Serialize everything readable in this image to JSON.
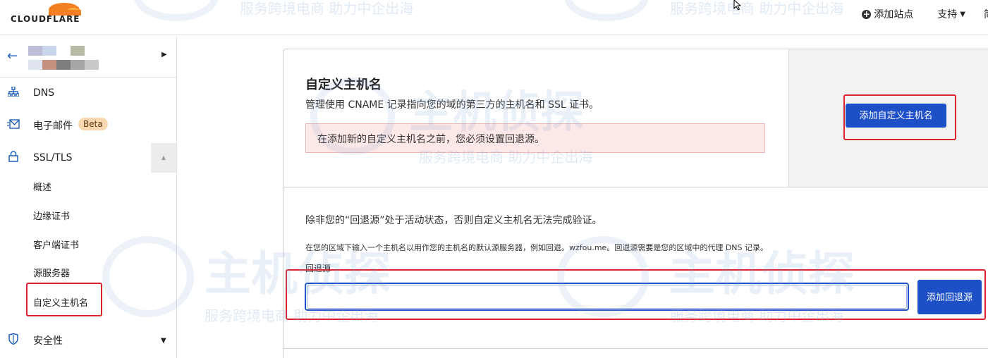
{
  "header": {
    "brand": "CLOUDFLARE",
    "add_site": "添加站点",
    "support": "支持",
    "lang": "简"
  },
  "sidebar": {
    "items": [
      {
        "label": "DNS",
        "icon": "sitemap-icon"
      },
      {
        "label": "电子邮件",
        "icon": "envelope-icon",
        "badge": "Beta"
      },
      {
        "label": "SSL/TLS",
        "icon": "lock-icon"
      },
      {
        "label": "安全性",
        "icon": "shield-icon"
      }
    ],
    "ssl_sub": [
      "概述",
      "边缘证书",
      "客户端证书",
      "源服务器",
      "自定义主机名"
    ]
  },
  "main": {
    "title": "自定义主机名",
    "description": "管理使用 CNAME 记录指向您的域的第三方的主机名和 SSL 证书。",
    "warning": "在添加新的自定义主机名之前，您必须设置回退源。",
    "add_hostname_button": "添加自定义主机名",
    "fallback_note": "除非您的“回退源”处于活动状态，否则自定义主机名无法完成验证。",
    "fallback_detail": "在您的区域下输入一个主机名以用作您的主机名的默认源服务器，例如回退。wzfou.me。回退源需要是您的区域中的代理 DNS 记录。",
    "fallback_label": "回退源",
    "fallback_input_value": "",
    "add_fallback_button": "添加回退源"
  },
  "watermark": {
    "main": "主机侦探",
    "sub": "服务跨境电商  助力中企出海"
  },
  "colors": {
    "accent": "#1d4fc7",
    "highlight": "#d9232e",
    "warning_bg": "#fde8e8",
    "beta_bg": "#fbd7b0",
    "cloudflare_orange": "#f38020"
  }
}
